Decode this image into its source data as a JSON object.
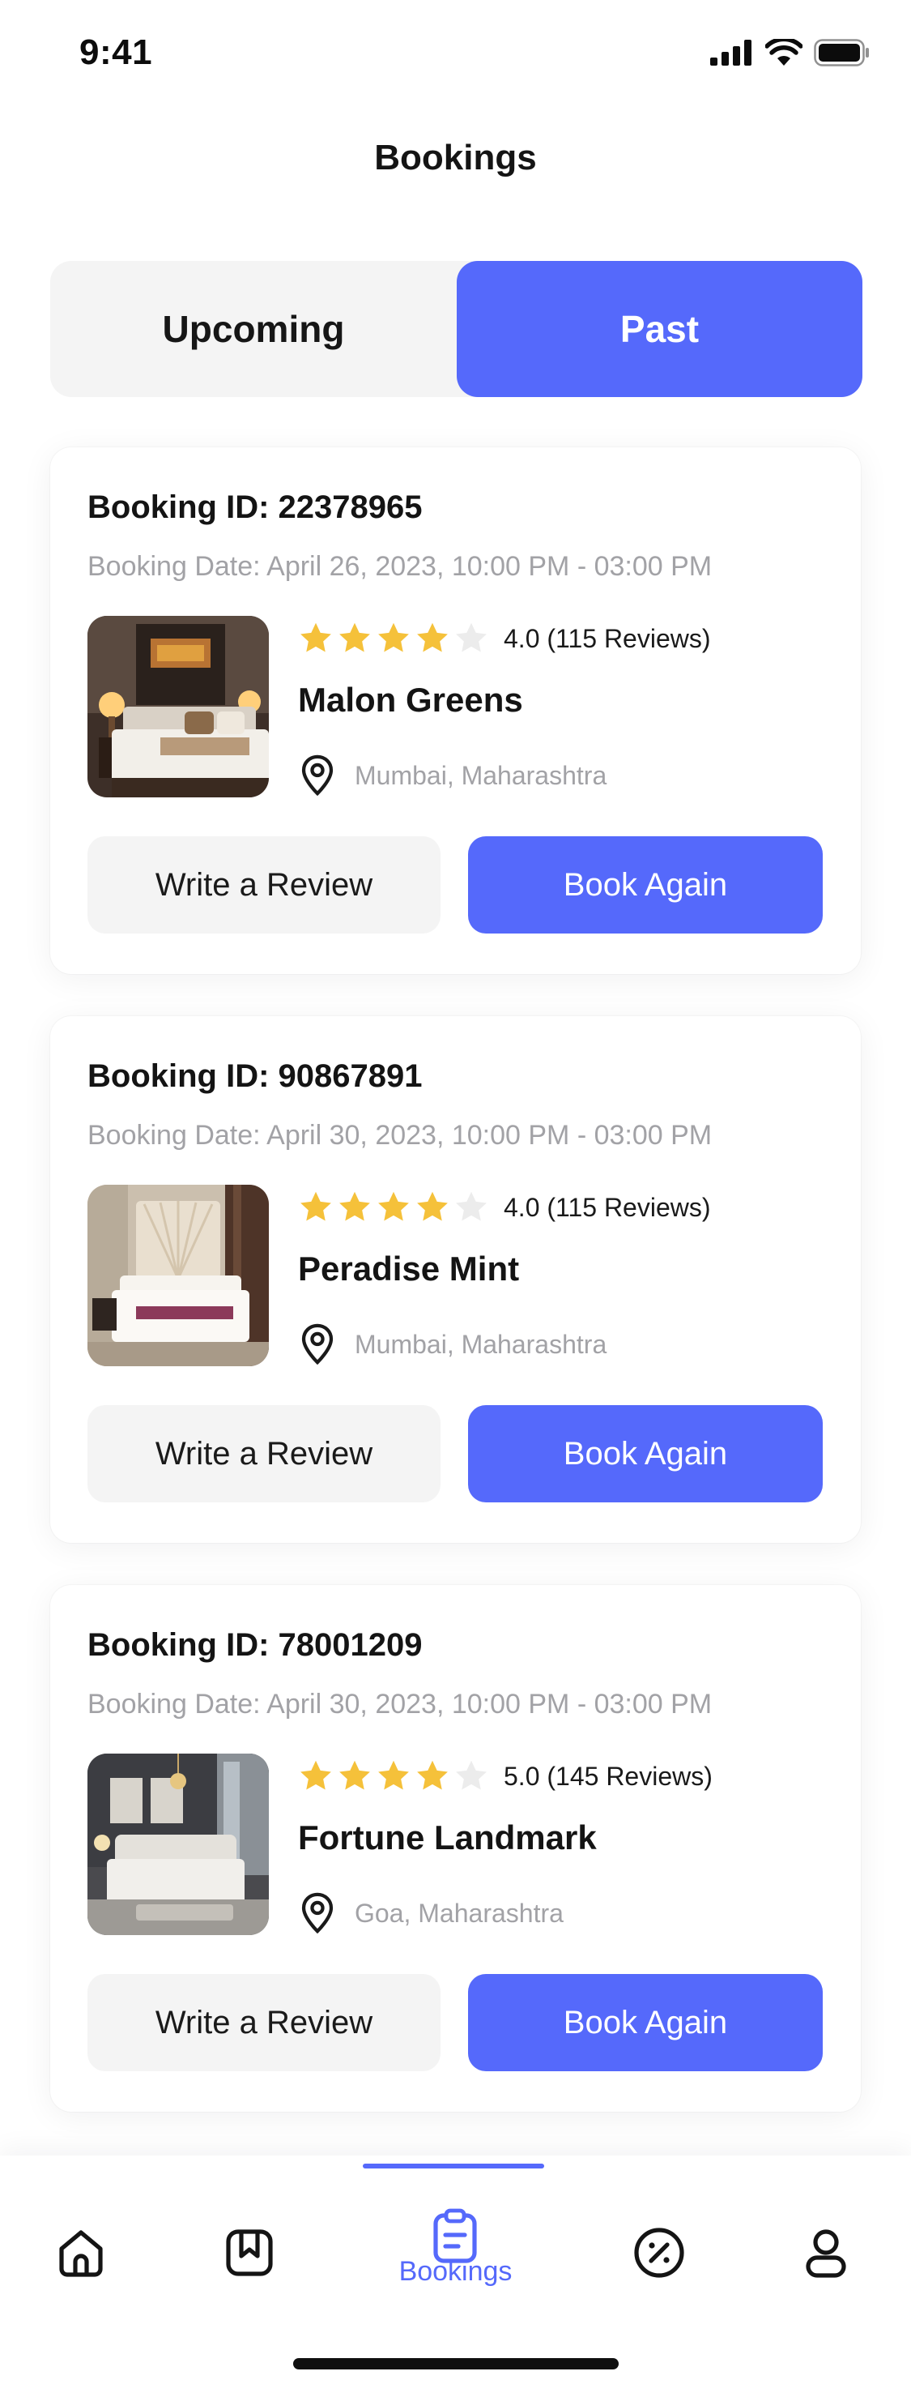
{
  "status_bar": {
    "time": "9:41",
    "icons": [
      "signal-icon",
      "wifi-icon",
      "battery-icon"
    ]
  },
  "header": {
    "title": "Bookings"
  },
  "tabs": [
    {
      "label": "Upcoming",
      "active": false
    },
    {
      "label": "Past",
      "active": true
    }
  ],
  "colors": {
    "accent": "#5569fb",
    "star": "#f5c13a",
    "star_empty": "#ececec",
    "muted_text": "#a2a2a6",
    "surface": "#f4f4f4"
  },
  "bookings": [
    {
      "booking_id": "Booking ID: 22378965",
      "booking_date": "Booking Date: April 26, 2023, 10:00 PM - 03:00 PM",
      "stars": 4,
      "rating_text": "4.0 (115 Reviews)",
      "hotel_name": "Malon Greens",
      "location": "Mumbai, Maharashtra",
      "review_label": "Write a Review",
      "book_again_label": "Book Again"
    },
    {
      "booking_id": "Booking ID: 90867891",
      "booking_date": "Booking Date: April 30, 2023, 10:00 PM - 03:00 PM",
      "stars": 4,
      "rating_text": "4.0 (115 Reviews)",
      "hotel_name": "Peradise Mint",
      "location": "Mumbai, Maharashtra",
      "review_label": "Write a Review",
      "book_again_label": "Book Again"
    },
    {
      "booking_id": "Booking ID: 78001209",
      "booking_date": "Booking Date: April 30, 2023, 10:00 PM - 03:00 PM",
      "stars": 4,
      "rating_text": "5.0 (145 Reviews)",
      "hotel_name": "Fortune Landmark",
      "location": "Goa, Maharashtra",
      "review_label": "Write a Review",
      "book_again_label": "Book Again"
    }
  ],
  "bottom_nav": {
    "items": [
      {
        "icon": "home-icon",
        "active": false
      },
      {
        "icon": "bookmark-icon",
        "active": false
      },
      {
        "icon": "clipboard-icon",
        "label": "Bookings",
        "active": true
      },
      {
        "icon": "discount-icon",
        "active": false
      },
      {
        "icon": "profile-icon",
        "active": false
      }
    ]
  }
}
